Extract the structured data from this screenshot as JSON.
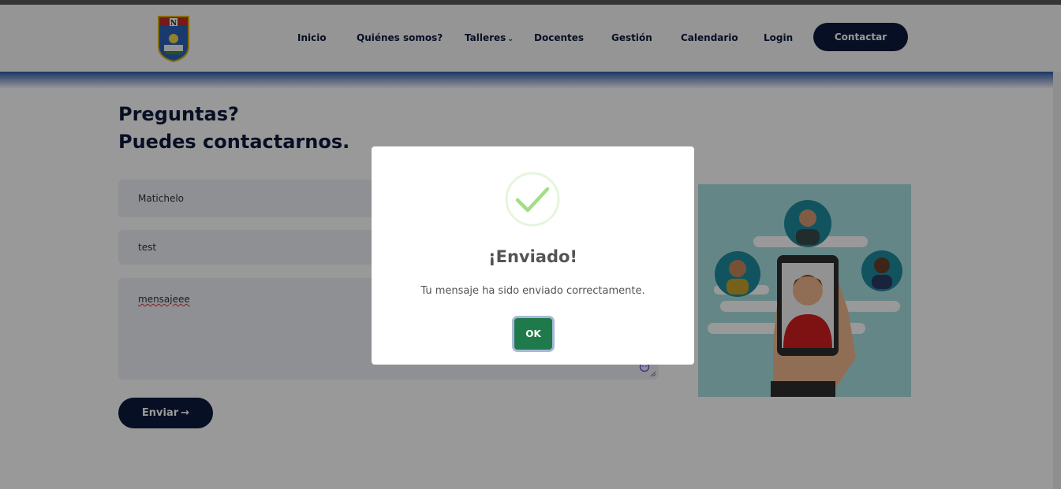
{
  "nav": {
    "items": [
      {
        "label": "Inicio"
      },
      {
        "label": "Quiénes somos?"
      },
      {
        "label": "Talleres"
      },
      {
        "label": "Docentes"
      },
      {
        "label": "Gestión"
      },
      {
        "label": "Calendario"
      },
      {
        "label": "Login"
      }
    ],
    "contact_label": "Contactar"
  },
  "contact": {
    "heading_line1": "Preguntas?",
    "heading_line2": "Puedes contactarnos.",
    "name_value": "Matichelo",
    "subject_value": "test",
    "message_value": "mensajeee",
    "send_label": "Enviar"
  },
  "modal": {
    "title": "¡Enviado!",
    "text": "Tu mensaje ha sido enviado correctamente.",
    "ok_label": "OK"
  },
  "colors": {
    "brand_dark": "#0c1a3c",
    "ok_green": "#1e7a4a",
    "success_check": "#a5dc86"
  }
}
